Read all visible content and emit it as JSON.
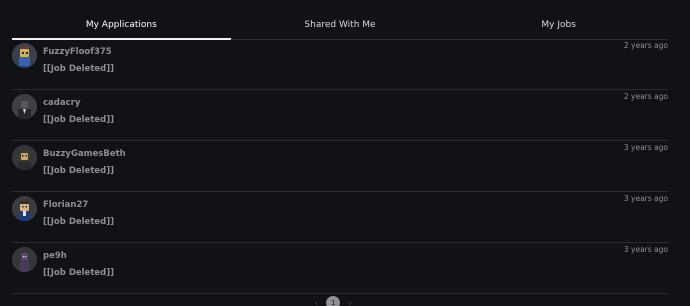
{
  "tabs": [
    {
      "label": "My Applications",
      "active": true
    },
    {
      "label": "Shared With Me",
      "active": false
    },
    {
      "label": "My Jobs",
      "active": false
    }
  ],
  "applications": [
    {
      "username": "FuzzyFloof375",
      "job": "[[Job Deleted]]",
      "time": "2 years ago",
      "avatar": "avatar-fuzzyfloof375"
    },
    {
      "username": "cadacry",
      "job": "[[Job Deleted]]",
      "time": "2 years ago",
      "avatar": "avatar-cadacry"
    },
    {
      "username": "BuzzyGamesBeth",
      "job": "[[Job Deleted]]",
      "time": "3 years ago",
      "avatar": "avatar-buzzygamesbeth"
    },
    {
      "username": "Florian27",
      "job": "[[Job Deleted]]",
      "time": "3 years ago",
      "avatar": "avatar-florian27"
    },
    {
      "username": "pe9h",
      "job": "[[Job Deleted]]",
      "time": "3 years ago",
      "avatar": "avatar-pe9h"
    }
  ],
  "pagination": {
    "prev_icon": "chevron-left-icon",
    "current_page": "1",
    "next_icon": "chevron-right-icon"
  },
  "colors": {
    "background": "#111216",
    "text_primary": "#ffffff",
    "text_muted": "#8d8f94",
    "divider": "#2a2c31"
  }
}
